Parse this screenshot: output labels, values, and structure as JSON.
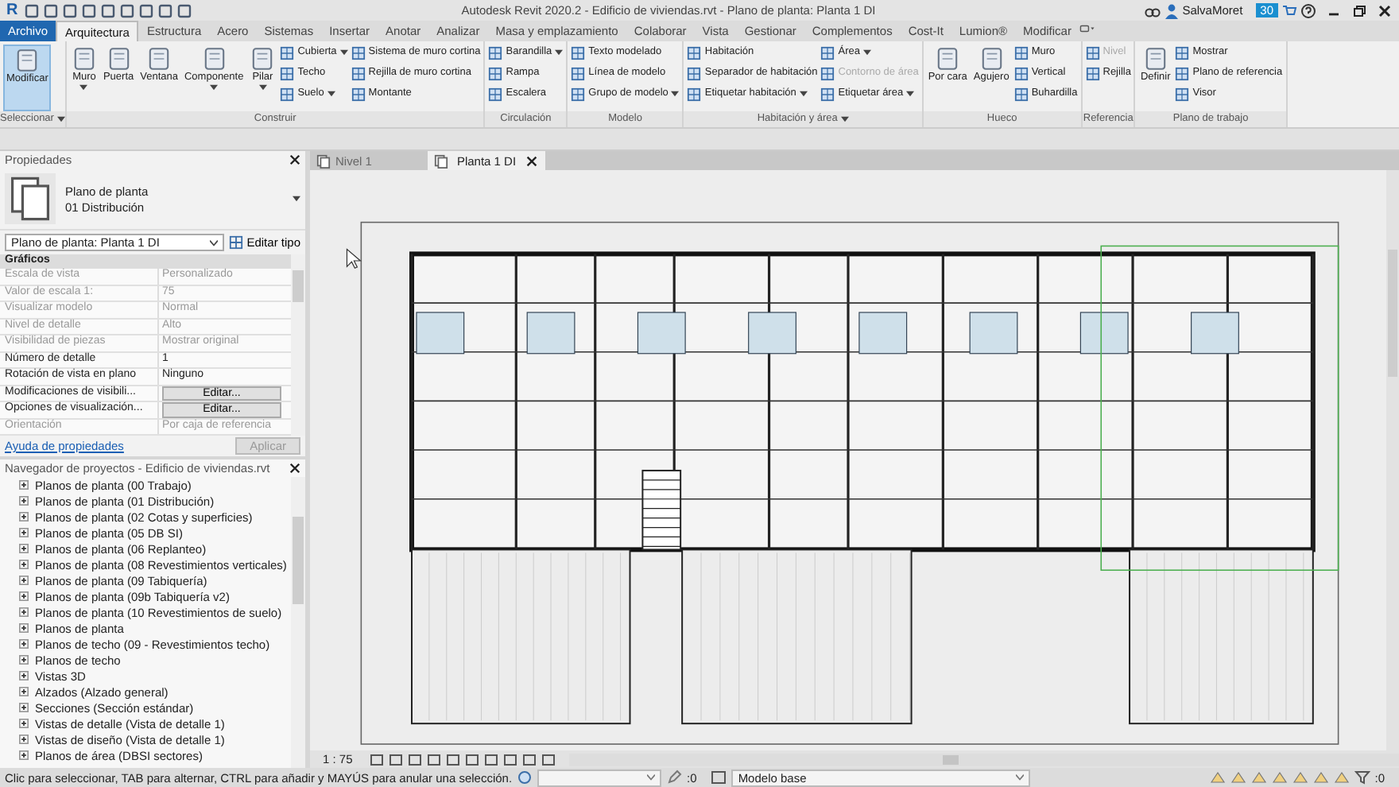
{
  "title_bar": {
    "logo": "R",
    "title": "Autodesk Revit 2020.2 - Edificio de viviendas.rvt - Plano de planta: Planta 1 DI",
    "user": "SalvaMoret",
    "badge": "30"
  },
  "menu_tabs": [
    {
      "label": "Archivo",
      "kind": "file",
      "selected": false
    },
    {
      "label": "Arquitectura",
      "kind": "tab",
      "selected": true
    },
    {
      "label": "Estructura",
      "kind": "tab",
      "selected": false
    },
    {
      "label": "Acero",
      "kind": "tab",
      "selected": false
    },
    {
      "label": "Sistemas",
      "kind": "tab",
      "selected": false
    },
    {
      "label": "Insertar",
      "kind": "tab",
      "selected": false
    },
    {
      "label": "Anotar",
      "kind": "tab",
      "selected": false
    },
    {
      "label": "Analizar",
      "kind": "tab",
      "selected": false
    },
    {
      "label": "Masa y emplazamiento",
      "kind": "tab",
      "selected": false
    },
    {
      "label": "Colaborar",
      "kind": "tab",
      "selected": false
    },
    {
      "label": "Vista",
      "kind": "tab",
      "selected": false
    },
    {
      "label": "Gestionar",
      "kind": "tab",
      "selected": false
    },
    {
      "label": "Complementos",
      "kind": "tab",
      "selected": false
    },
    {
      "label": "Cost-It",
      "kind": "tab",
      "selected": false
    },
    {
      "label": "Lumion®",
      "kind": "tab",
      "selected": false
    },
    {
      "label": "Modificar",
      "kind": "tab",
      "selected": false
    }
  ],
  "ribbon": {
    "panels": [
      {
        "label": "Seleccionar",
        "menu": true,
        "columns": [
          {
            "kind": "large",
            "label": "Modificar",
            "selected": true,
            "dropdown": false
          }
        ]
      },
      {
        "label": "Construir",
        "menu": false,
        "columns": [
          {
            "kind": "large",
            "label": "Muro",
            "selected": false,
            "dropdown": true
          },
          {
            "kind": "large",
            "label": "Puerta",
            "selected": false,
            "dropdown": false
          },
          {
            "kind": "large",
            "label": "Ventana",
            "selected": false,
            "dropdown": false
          },
          {
            "kind": "large",
            "label": "Componente",
            "selected": false,
            "dropdown": true
          },
          {
            "kind": "large",
            "label": "Pilar",
            "selected": false,
            "dropdown": true
          },
          {
            "kind": "stack",
            "items": [
              {
                "label": "Cubierta",
                "dropdown": true,
                "disabled": false
              },
              {
                "label": "Techo",
                "dropdown": false,
                "disabled": false
              },
              {
                "label": "Suelo",
                "dropdown": true,
                "disabled": false
              }
            ]
          },
          {
            "kind": "stack",
            "items": [
              {
                "label": "Sistema de muro cortina",
                "dropdown": false,
                "disabled": false
              },
              {
                "label": "Rejilla de muro cortina",
                "dropdown": false,
                "disabled": false
              },
              {
                "label": "Montante",
                "dropdown": false,
                "disabled": false
              }
            ]
          }
        ]
      },
      {
        "label": "Circulación",
        "menu": false,
        "columns": [
          {
            "kind": "stack",
            "items": [
              {
                "label": "Barandilla",
                "dropdown": true,
                "disabled": false
              },
              {
                "label": "Rampa",
                "dropdown": false,
                "disabled": false
              },
              {
                "label": "Escalera",
                "dropdown": false,
                "disabled": false
              }
            ]
          }
        ]
      },
      {
        "label": "Modelo",
        "menu": false,
        "columns": [
          {
            "kind": "stack",
            "items": [
              {
                "label": "Texto modelado",
                "dropdown": false,
                "disabled": false
              },
              {
                "label": "Línea de modelo",
                "dropdown": false,
                "disabled": false
              },
              {
                "label": "Grupo de modelo",
                "dropdown": true,
                "disabled": false
              }
            ]
          }
        ]
      },
      {
        "label": "Habitación y área",
        "menu": true,
        "columns": [
          {
            "kind": "stack",
            "items": [
              {
                "label": "Habitación",
                "dropdown": false,
                "disabled": false
              },
              {
                "label": "Separador de habitación",
                "dropdown": false,
                "disabled": false
              },
              {
                "label": "Etiquetar habitación",
                "dropdown": true,
                "disabled": false
              }
            ]
          },
          {
            "kind": "stack",
            "items": [
              {
                "label": "Área",
                "dropdown": true,
                "disabled": false
              },
              {
                "label": "Contorno de área",
                "dropdown": false,
                "disabled": true
              },
              {
                "label": "Etiquetar área",
                "dropdown": true,
                "disabled": false
              }
            ]
          }
        ]
      },
      {
        "label": "Hueco",
        "menu": false,
        "columns": [
          {
            "kind": "large",
            "label": "Por cara",
            "selected": false,
            "dropdown": false
          },
          {
            "kind": "large",
            "label": "Agujero",
            "selected": false,
            "dropdown": false
          },
          {
            "kind": "stack",
            "items": [
              {
                "label": "Muro",
                "dropdown": false,
                "disabled": false
              },
              {
                "label": "Vertical",
                "dropdown": false,
                "disabled": false
              },
              {
                "label": "Buhardilla",
                "dropdown": false,
                "disabled": false
              }
            ]
          }
        ]
      },
      {
        "label": "Referencia",
        "menu": false,
        "columns": [
          {
            "kind": "stack",
            "items": [
              {
                "label": "Nivel",
                "dropdown": false,
                "disabled": true
              },
              {
                "label": "Rejilla",
                "dropdown": false,
                "disabled": false
              }
            ]
          }
        ]
      },
      {
        "label": "Plano de trabajo",
        "menu": false,
        "columns": [
          {
            "kind": "large",
            "label": "Definir",
            "selected": false,
            "dropdown": false
          },
          {
            "kind": "stack",
            "items": [
              {
                "label": "Mostrar",
                "dropdown": false,
                "disabled": false
              },
              {
                "label": "Plano de referencia",
                "dropdown": false,
                "disabled": false
              },
              {
                "label": "Visor",
                "dropdown": false,
                "disabled": false
              }
            ]
          }
        ]
      }
    ]
  },
  "properties": {
    "title": "Propiedades",
    "type_lines": [
      "Plano de planta",
      "01 Distribución"
    ],
    "selector": "Plano de planta: Planta 1 DI",
    "edit_type": "Editar tipo",
    "group": "Gráficos",
    "rows": [
      {
        "name": "Escala de vista",
        "value": "Personalizado",
        "kind": "text",
        "disabled": true
      },
      {
        "name": "Valor de escala    1:",
        "value": "75",
        "kind": "text",
        "disabled": true
      },
      {
        "name": "Visualizar modelo",
        "value": "Normal",
        "kind": "text",
        "disabled": true
      },
      {
        "name": "Nivel de detalle",
        "value": "Alto",
        "kind": "text",
        "disabled": true
      },
      {
        "name": "Visibilidad de piezas",
        "value": "Mostrar original",
        "kind": "text",
        "disabled": true
      },
      {
        "name": "Número de detalle",
        "value": "1",
        "kind": "text",
        "disabled": false
      },
      {
        "name": "Rotación de vista en plano",
        "value": "Ninguno",
        "kind": "text",
        "disabled": false
      },
      {
        "name": "Modificaciones de visibili...",
        "value": "Editar...",
        "kind": "button",
        "disabled": false
      },
      {
        "name": "Opciones de visualización...",
        "value": "Editar...",
        "kind": "button",
        "disabled": false
      },
      {
        "name": "Orientación",
        "value": "Por caja de referencia",
        "kind": "text",
        "disabled": true
      }
    ],
    "help_link": "Ayuda de propiedades",
    "apply": "Aplicar",
    "apply_disabled": true
  },
  "browser": {
    "title": "Navegador de proyectos - Edificio de viviendas.rvt",
    "items": [
      {
        "label": "Planos de planta (00 Trabajo)",
        "expanded": false
      },
      {
        "label": "Planos de planta (01 Distribución)",
        "expanded": false
      },
      {
        "label": "Planos de planta (02 Cotas y superficies)",
        "expanded": false
      },
      {
        "label": "Planos de planta (05 DB SI)",
        "expanded": false
      },
      {
        "label": "Planos de planta (06 Replanteo)",
        "expanded": false
      },
      {
        "label": "Planos de planta (08 Revestimientos verticales)",
        "expanded": false
      },
      {
        "label": "Planos de planta (09 Tabiquería)",
        "expanded": false
      },
      {
        "label": "Planos de planta (09b Tabiquería v2)",
        "expanded": false
      },
      {
        "label": "Planos de planta (10 Revestimientos de suelo)",
        "expanded": false
      },
      {
        "label": "Planos de planta",
        "expanded": false
      },
      {
        "label": "Planos de techo (09 - Revestimientos techo)",
        "expanded": false
      },
      {
        "label": "Planos de techo",
        "expanded": false
      },
      {
        "label": "Vistas 3D",
        "expanded": false
      },
      {
        "label": "Alzados (Alzado general)",
        "expanded": false
      },
      {
        "label": "Secciones (Sección estándar)",
        "expanded": false
      },
      {
        "label": "Vistas de detalle (Vista de detalle 1)",
        "expanded": false
      },
      {
        "label": "Vistas de diseño (Vista de detalle 1)",
        "expanded": false
      },
      {
        "label": "Planos de área (DBSI sectores)",
        "expanded": false
      }
    ]
  },
  "view_tabs": [
    {
      "label": "Nivel 1",
      "selected": false
    },
    {
      "label": "Planta 1 DI",
      "selected": true
    }
  ],
  "view_bar": {
    "scale": "1 : 75"
  },
  "status_bar": {
    "message": "Clic para seleccionar, TAB para alternar, CTRL para añadir y MAYÚS para anular una selección.",
    "count": ":0",
    "model": "Modelo base",
    "filter_count": ":0"
  }
}
